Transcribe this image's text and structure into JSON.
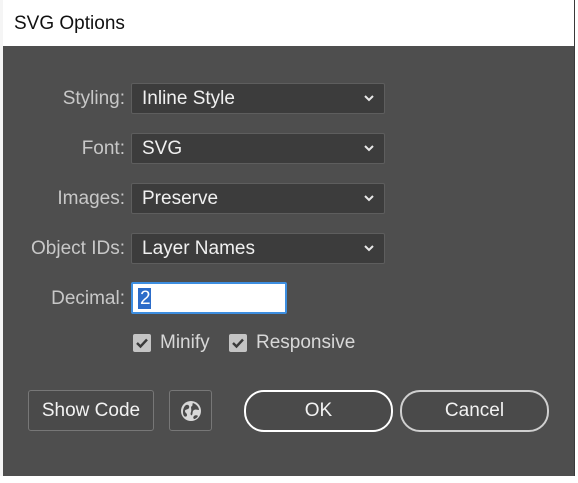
{
  "dialog": {
    "title": "SVG Options"
  },
  "fields": {
    "styling": {
      "label": "Styling:",
      "value": "Inline Style"
    },
    "font": {
      "label": "Font:",
      "value": "SVG"
    },
    "images": {
      "label": "Images:",
      "value": "Preserve"
    },
    "object_ids": {
      "label": "Object IDs:",
      "value": "Layer Names"
    },
    "decimal": {
      "label": "Decimal:",
      "value": "2"
    }
  },
  "options": {
    "minify": {
      "label": "Minify",
      "checked": true
    },
    "responsive": {
      "label": "Responsive",
      "checked": true
    }
  },
  "buttons": {
    "show_code": "Show Code",
    "browser_icon": "globe-icon",
    "ok": "OK",
    "cancel": "Cancel"
  },
  "colors": {
    "dialog_bg": "#4e4e4e",
    "field_bg": "#3c3c3c",
    "focus_border": "#3d8ee0",
    "selection": "#2c6cc9"
  }
}
